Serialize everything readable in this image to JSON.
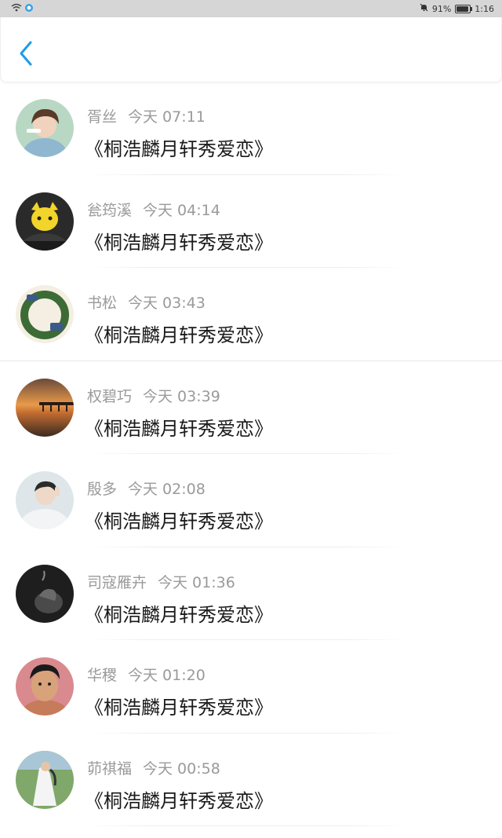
{
  "status_bar": {
    "left_icons": [
      "wifi-icon",
      "cloud-icon"
    ],
    "battery_percent": "91%",
    "battery_level": 0.91,
    "time": "1:16"
  },
  "header": {
    "back_icon": "chevron-left-icon"
  },
  "comments": [
    {
      "name": "胥丝",
      "time": "今天 07:11",
      "text": "《桐浩麟月轩秀爱恋》"
    },
    {
      "name": "瓮筠溪",
      "time": "今天 04:14",
      "text": "《桐浩麟月轩秀爱恋》"
    },
    {
      "name": "书松",
      "time": "今天 03:43",
      "text": "《桐浩麟月轩秀爱恋》"
    },
    {
      "name": "权碧巧",
      "time": "今天 03:39",
      "text": "《桐浩麟月轩秀爱恋》"
    },
    {
      "name": "殷多",
      "time": "今天 02:08",
      "text": "《桐浩麟月轩秀爱恋》"
    },
    {
      "name": "司寇雁卉",
      "time": "今天 01:36",
      "text": "《桐浩麟月轩秀爱恋》"
    },
    {
      "name": "华稷",
      "time": "今天 01:20",
      "text": "《桐浩麟月轩秀爱恋》"
    },
    {
      "name": "茆祺福",
      "time": "今天 00:58",
      "text": "《桐浩麟月轩秀爱恋》"
    }
  ],
  "colors": {
    "accent": "#1e9be8",
    "name_gray": "#9a9a9a",
    "status_bar": "#d6d6d6"
  }
}
